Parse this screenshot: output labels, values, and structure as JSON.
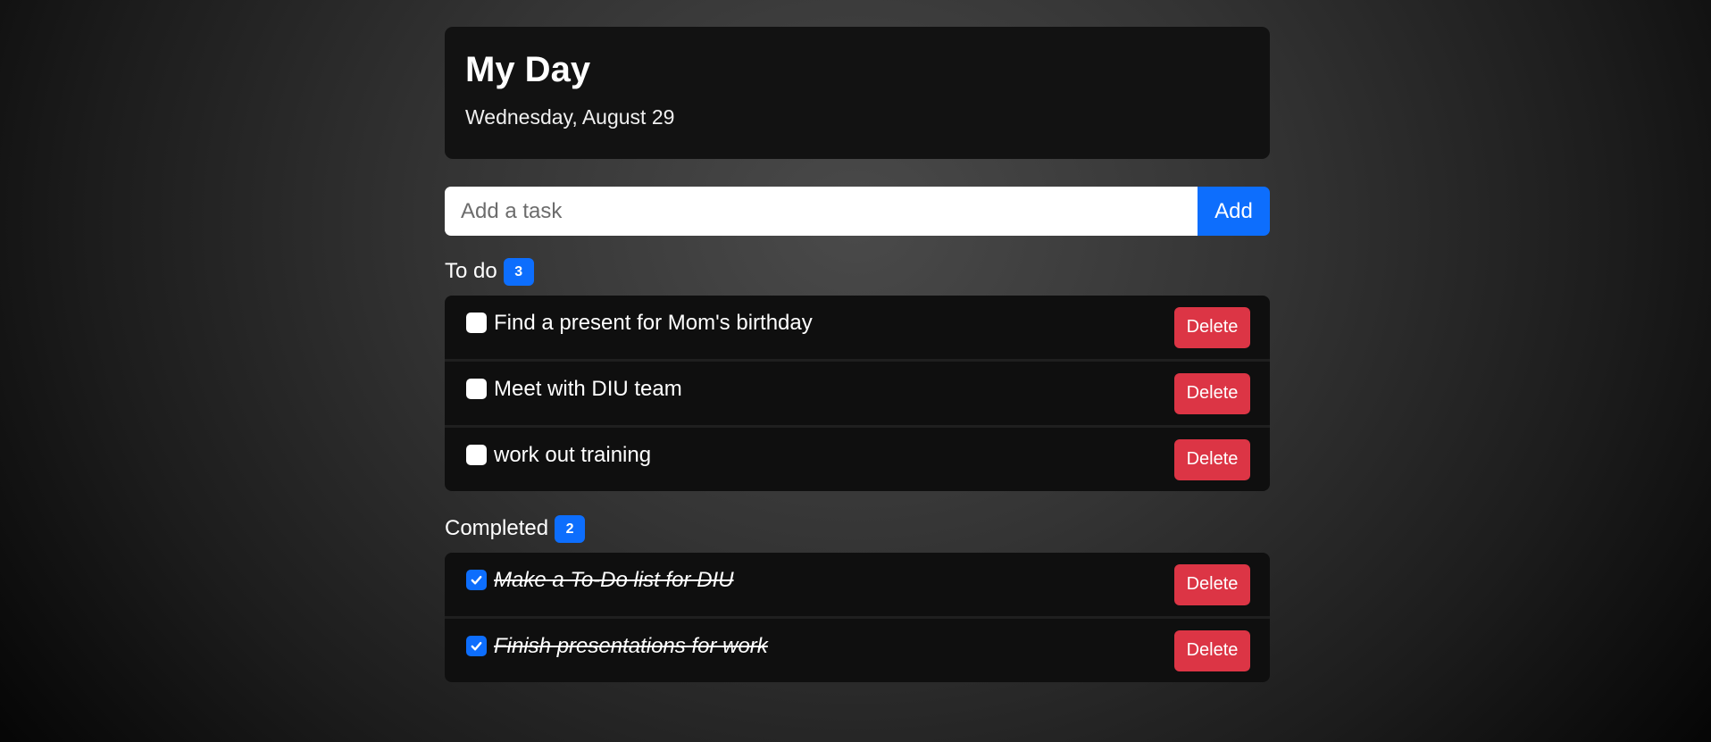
{
  "header": {
    "title": "My Day",
    "date": "Wednesday, August 29"
  },
  "add_task": {
    "placeholder": "Add a task",
    "value": "",
    "button_label": "Add"
  },
  "todo": {
    "label": "To do",
    "count": "3",
    "items": [
      {
        "text": "Find a present for Mom's birthday",
        "checked": false,
        "delete_label": "Delete"
      },
      {
        "text": "Meet with DIU team",
        "checked": false,
        "delete_label": "Delete"
      },
      {
        "text": "work out training",
        "checked": false,
        "delete_label": "Delete"
      }
    ]
  },
  "completed": {
    "label": "Completed",
    "count": "2",
    "items": [
      {
        "text": "Make a To-Do list for DIU",
        "checked": true,
        "delete_label": "Delete"
      },
      {
        "text": "Finish presentations for work",
        "checked": true,
        "delete_label": "Delete"
      }
    ]
  },
  "colors": {
    "accent": "#0d6efd",
    "danger": "#dc3545",
    "card_bg": "#121212"
  },
  "icons": {
    "checkmark": "check-icon"
  }
}
